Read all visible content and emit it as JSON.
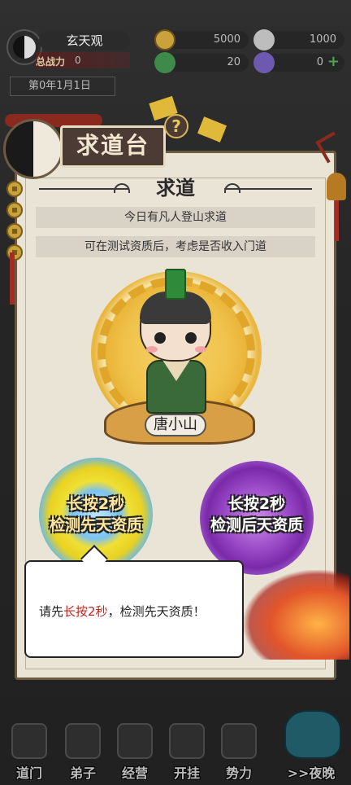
{
  "hud": {
    "sect_name": "玄天观",
    "power_label": "总战力",
    "power_value": "0",
    "date": "第0年1月1日",
    "resources": [
      {
        "icon": "coin-icon",
        "value": "5000"
      },
      {
        "icon": "cloud-icon",
        "value": "1000"
      },
      {
        "icon": "jade-icon",
        "value": "20"
      },
      {
        "icon": "gem-icon",
        "value": "0",
        "has_add": true
      }
    ],
    "add_symbol": "+"
  },
  "panel": {
    "title": "求道台",
    "help_symbol": "?",
    "section_title": "求道",
    "info_lines": [
      "今日有凡人登山求道",
      "可在测试资质后，考虑是否收入门道"
    ],
    "character_name": "唐小山",
    "actions": [
      {
        "line1": "长按2秒",
        "line2": "检测先天资质"
      },
      {
        "line1": "长按2秒",
        "line2": "检测后天资质"
      }
    ]
  },
  "tooltip": {
    "prefix": "请先",
    "highlight": "长按2秒",
    "suffix": "，检测先天资质！",
    "highlight_color": "#c0281f"
  },
  "nav": {
    "items": [
      {
        "label": "道门",
        "icon": "taiji-gate-icon"
      },
      {
        "label": "弟子",
        "icon": "disciple-icon"
      },
      {
        "label": "经营",
        "icon": "shop-icon"
      },
      {
        "label": "开挂",
        "icon": "yinyang-icon"
      },
      {
        "label": "势力",
        "icon": "faction-icon"
      }
    ],
    "night_label": ">>夜晚"
  },
  "colors": {
    "panel_bg": "#e9e4d6",
    "innate_orb": "#e8d222",
    "acquired_orb": "#9a4ac7"
  }
}
